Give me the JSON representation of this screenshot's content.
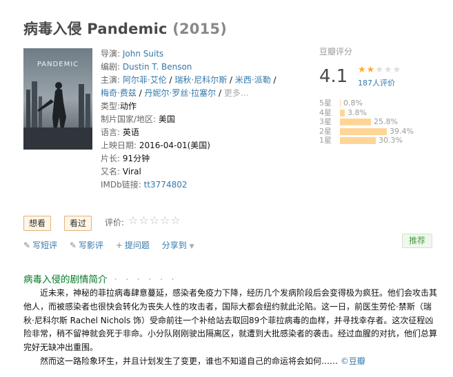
{
  "title": {
    "name": "病毒入侵 Pandemic",
    "year": "(2015)"
  },
  "poster": {
    "title_text": "PANDEMIC"
  },
  "info": {
    "director_label": "导演:",
    "director": "John Suits",
    "writer_label": "编剧:",
    "writer": "Dustin T. Benson",
    "cast_label": "主演:",
    "cast_line1": [
      "阿尔菲·艾伦",
      "瑞秋·尼科尔斯",
      "米西·派勒"
    ],
    "cast_line2": [
      "梅奇·费兹",
      "丹妮尔·罗丝·拉塞尔"
    ],
    "cast_more": "更多...",
    "genre_label": "类型:",
    "genre": "动作",
    "country_label": "制片国家/地区:",
    "country": "美国",
    "language_label": "语言:",
    "language": "英语",
    "release_label": "上映日期:",
    "release": "2016-04-01(美国)",
    "runtime_label": "片长:",
    "runtime": "91分钟",
    "aka_label": "又名:",
    "aka": "Viral",
    "imdb_label": "IMDb链接:",
    "imdb": "tt3774802"
  },
  "rating": {
    "label": "豆瓣评分",
    "score": "4.1",
    "stars_on": 2,
    "stars_total": 5,
    "votes": "187人评价",
    "distribution": [
      {
        "label": "5星",
        "pct": "0.8%",
        "value": 0.8
      },
      {
        "label": "4星",
        "pct": "3.8%",
        "value": 3.8
      },
      {
        "label": "3星",
        "pct": "25.8%",
        "value": 25.8
      },
      {
        "label": "2星",
        "pct": "39.4%",
        "value": 39.4
      },
      {
        "label": "1星",
        "pct": "30.3%",
        "value": 30.3
      }
    ],
    "accent_color": "#ffac2d",
    "bar_color": "#ffd596"
  },
  "buttons": {
    "want": "想看",
    "seen": "看过",
    "rate_label": "评价:"
  },
  "actions": {
    "short_review": "写短评",
    "review": "写影评",
    "ask": "提问题",
    "share": "分享到"
  },
  "recommend": "推荐",
  "summary": {
    "heading": "病毒入侵的剧情简介",
    "dots": "· · · · · ·",
    "p1": "近未来，神秘的菲拉病毒肆意蔓延，感染者免疫力下降，经历几个发病阶段后会变得极为疯狂。他们会攻击其他人，而被感染者也很快会转化为丧失人性的攻击者，国际大都会纽约就此沦陷。这一日，前医生劳伦·禁斯（瑞秋·尼科尔斯 Rachel Nichols 饰）受命前往一个补给站去取回89个菲拉病毒的血样，并寻找幸存者。这次征程凶险非常，稍不留神就会死于非命。小分队刚刚驶出隔离区，就遭到大批感染者的袭击。经过血腥的对抗，他们总算完好无缺冲出重围。",
    "p2": "然而这一路险象环生，并且计划发生了变更，谁也不知道自己的命运将会如何……",
    "source": "©豆瓣"
  }
}
